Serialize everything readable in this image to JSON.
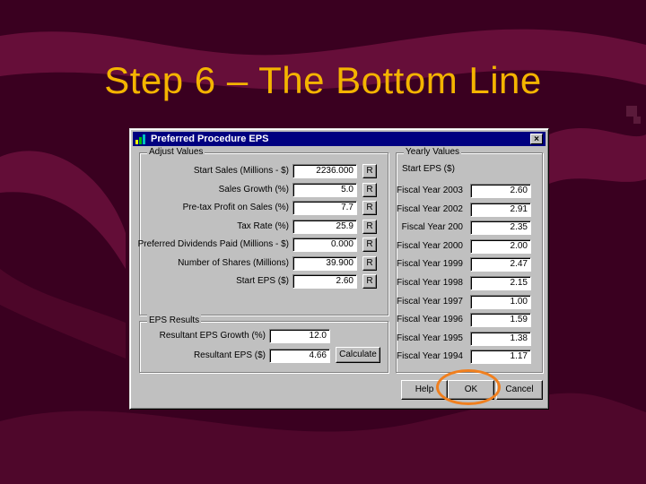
{
  "slide": {
    "title": "Step 6 – The Bottom Line",
    "colors": {
      "background": "#3a0020",
      "swoosh": "#6b0f3c",
      "title": "#f4b400",
      "highlight": "#f07f1e"
    }
  },
  "dialog": {
    "title": "Preferred Procedure EPS",
    "close_label": "×",
    "adjust_values": {
      "label": "Adjust Values",
      "rows": [
        {
          "label": "Start Sales (Millions - $)",
          "value": "2236.000",
          "button": "R"
        },
        {
          "label": "Sales Growth (%)",
          "value": "5.0",
          "button": "R"
        },
        {
          "label": "Pre-tax Profit on Sales (%)",
          "value": "7.7",
          "button": "R"
        },
        {
          "label": "Tax Rate (%)",
          "value": "25.9",
          "button": "R"
        },
        {
          "label": "Preferred Dividends Paid (Millions - $)",
          "value": "0.000",
          "button": "R"
        },
        {
          "label": "Number of Shares (Millions)",
          "value": "39.900",
          "button": "R"
        },
        {
          "label": "Start EPS ($)",
          "value": "2.60",
          "button": "R"
        }
      ]
    },
    "eps_results": {
      "label": "EPS Results",
      "rows": [
        {
          "label": "Resultant EPS Growth (%)",
          "value": "12.0"
        },
        {
          "label": "Resultant EPS ($)",
          "value": "4.66"
        }
      ],
      "calculate_label": "Calculate"
    },
    "yearly_values": {
      "label": "Yearly Values",
      "header": "Start EPS ($)",
      "rows": [
        {
          "label": "Fiscal Year 2003",
          "value": "2.60"
        },
        {
          "label": "Fiscal Year 2002",
          "value": "2.91"
        },
        {
          "label": "Fiscal Year 200",
          "value": "2.35"
        },
        {
          "label": "Fiscal Year 2000",
          "value": "2.00"
        },
        {
          "label": "Fiscal Year 1999",
          "value": "2.47"
        },
        {
          "label": "Fiscal Year 1998",
          "value": "2.15"
        },
        {
          "label": "Fiscal Year 1997",
          "value": "1.00"
        },
        {
          "label": "Fiscal Year 1996",
          "value": "1.59"
        },
        {
          "label": "Fiscal Year 1995",
          "value": "1.38"
        },
        {
          "label": "Fiscal Year 1994",
          "value": "1.17"
        }
      ]
    },
    "buttons": {
      "help": "Help",
      "ok": "OK",
      "cancel": "Cancel"
    }
  }
}
